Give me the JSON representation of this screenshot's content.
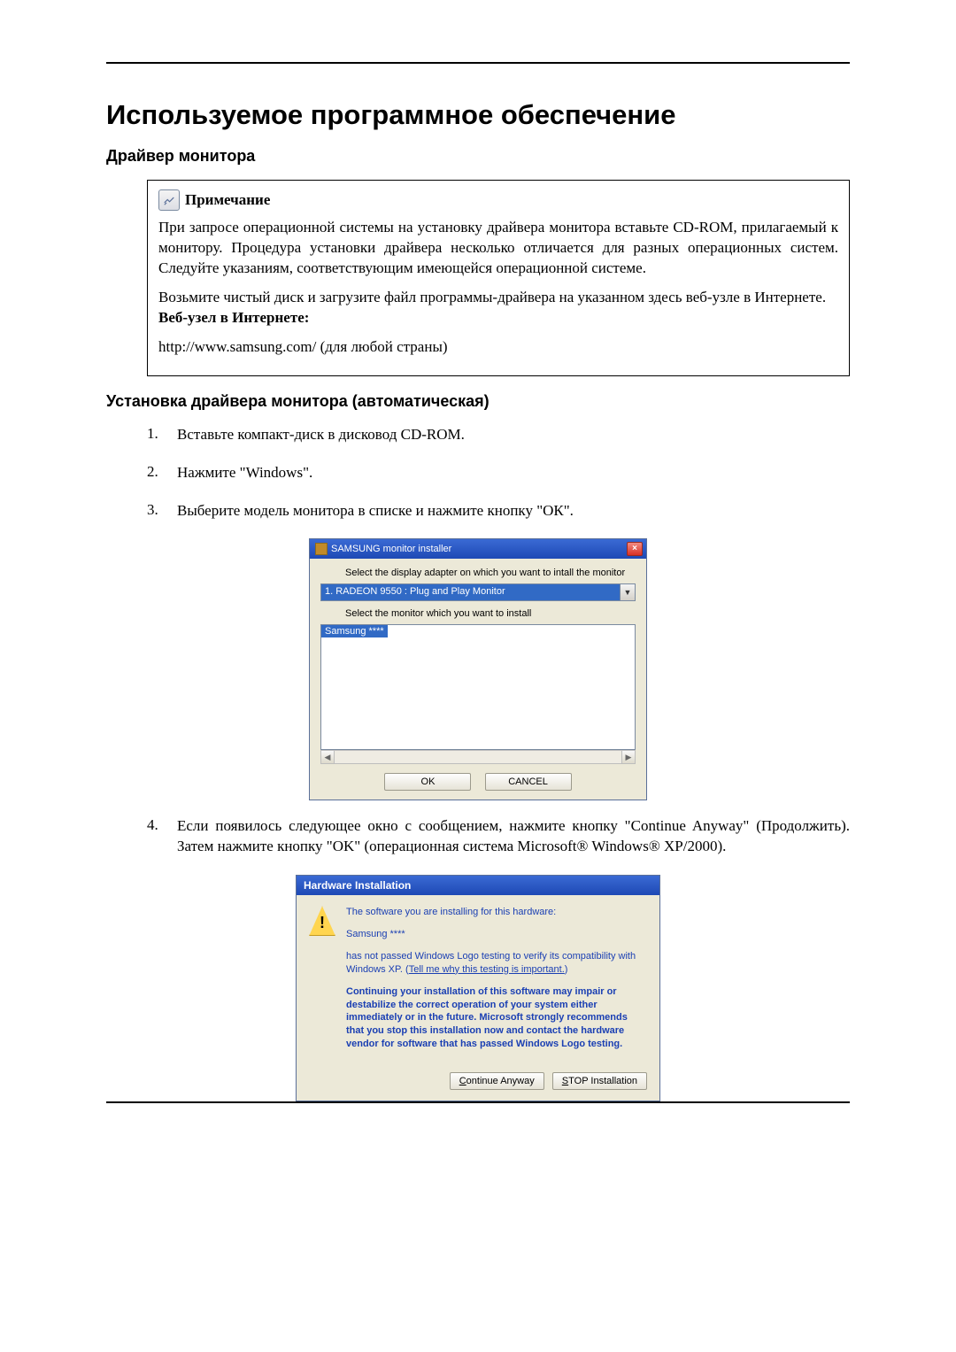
{
  "title": "Используемое программное обеспечение",
  "section1": "Драйвер монитора",
  "note": {
    "label": "Примечание",
    "p1": "При запросе операционной системы на установку драйвера монитора вставьте CD-ROM, прилагаемый к монитору. Процедура установки драйвера несколько отличается для разных операционных систем. Следуйте указаниям, соответствующим имеющейся операционной системе.",
    "p2": "Возьмите чистый диск и загрузите файл программы-драйвера на указанном здесь веб-узле в Интернете.",
    "p3_bold": "Веб-узел в Интернете:",
    "p4": "http://www.samsung.com/ (для любой страны)"
  },
  "section2": "Установка драйвера монитора (автоматическая)",
  "steps": {
    "1": "Вставьте компакт-диск в дисковод CD-ROM.",
    "2": "Нажмите \"Windows\".",
    "3": "Выберите модель монитора в списке и нажмите кнопку \"ОК\".",
    "4": "Если появилось следующее окно с сообщением, нажмите кнопку \"Continue Anyway\" (Продолжить). Затем нажмите кнопку \"OK\" (операционная система Microsoft® Windows® XP/2000)."
  },
  "installer": {
    "title": "SAMSUNG monitor installer",
    "line1": "Select the display adapter on which you want to intall the monitor",
    "adapter": "1. RADEON 9550 : Plug and Play Monitor",
    "line2": "Select the monitor which you want to install",
    "model": "Samsung ****",
    "ok": "OK",
    "cancel": "CANCEL"
  },
  "hw": {
    "title": "Hardware Installation",
    "l1": "The software you are installing for this hardware:",
    "l2": "Samsung ****",
    "l3a": "has not passed Windows Logo testing to verify its compatibility with Windows XP. (",
    "l3link": "Tell me why this testing is important.",
    "l3b": ")",
    "l4": "Continuing your installation of this software may impair or destabilize the correct operation of your system either immediately or in the future. Microsoft strongly recommends that you stop this installation now and contact the hardware vendor for software that has passed Windows Logo testing.",
    "btn_continue_pre": "C",
    "btn_continue_rest": "ontinue Anyway",
    "btn_stop_pre": "S",
    "btn_stop_rest": "TOP Installation"
  }
}
